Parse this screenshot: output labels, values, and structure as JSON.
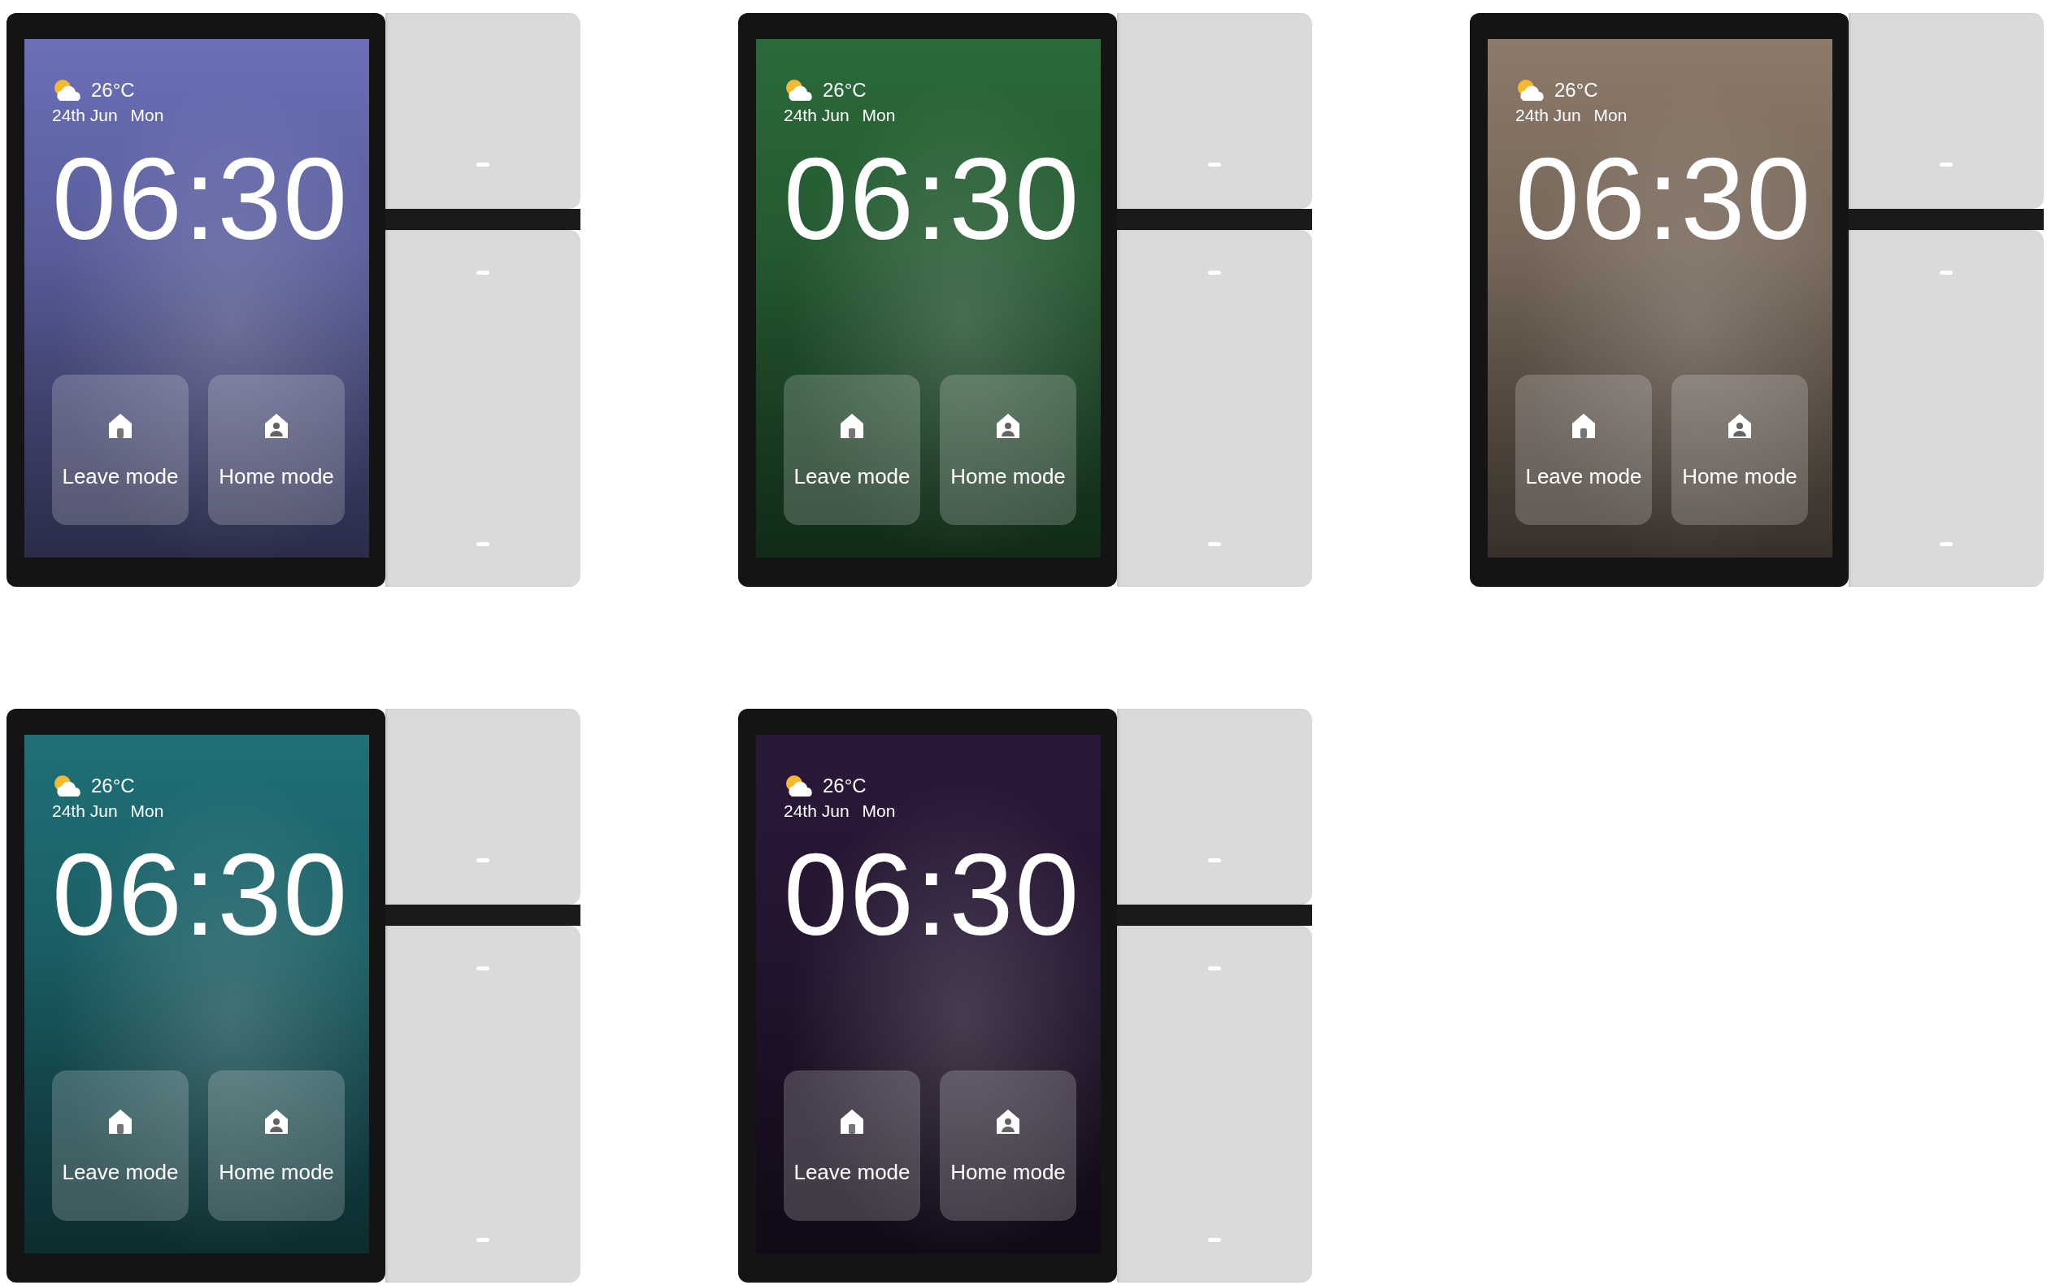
{
  "devices": [
    {
      "color": "#6a6fb8",
      "temperature": "26°C",
      "date": "24th Jun",
      "weekday": "Mon",
      "time": "06:30",
      "modes": [
        {
          "kind": "leave",
          "label": "Leave mode"
        },
        {
          "kind": "home",
          "label": "Home mode"
        }
      ]
    },
    {
      "color": "#2b6a3a",
      "temperature": "26°C",
      "date": "24th Jun",
      "weekday": "Mon",
      "time": "06:30",
      "modes": [
        {
          "kind": "leave",
          "label": "Leave mode"
        },
        {
          "kind": "home",
          "label": "Home mode"
        }
      ]
    },
    {
      "color": "#8c7a6a",
      "temperature": "26°C",
      "date": "24th Jun",
      "weekday": "Mon",
      "time": "06:30",
      "modes": [
        {
          "kind": "leave",
          "label": "Leave mode"
        },
        {
          "kind": "home",
          "label": "Home mode"
        }
      ]
    },
    {
      "color": "#1f7077",
      "temperature": "26°C",
      "date": "24th Jun",
      "weekday": "Mon",
      "time": "06:30",
      "modes": [
        {
          "kind": "leave",
          "label": "Leave mode"
        },
        {
          "kind": "home",
          "label": "Home mode"
        }
      ]
    },
    {
      "color": "#2a1838",
      "temperature": "26°C",
      "date": "24th Jun",
      "weekday": "Mon",
      "time": "06:30",
      "modes": [
        {
          "kind": "leave",
          "label": "Leave mode"
        },
        {
          "kind": "home",
          "label": "Home mode"
        }
      ]
    }
  ]
}
